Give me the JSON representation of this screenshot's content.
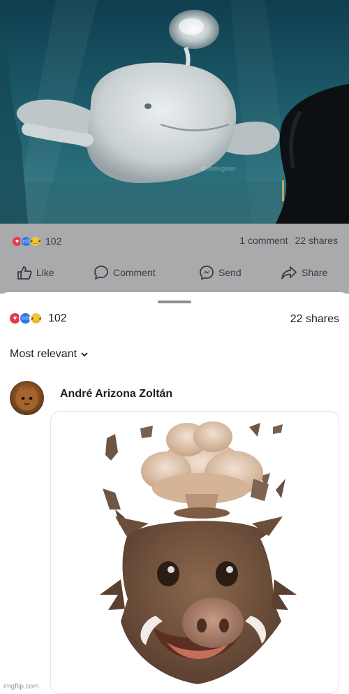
{
  "post": {
    "reaction_count": "102",
    "comments": "1 comment",
    "shares": "22 shares",
    "actions": {
      "like": "Like",
      "comment": "Comment",
      "send": "Send",
      "share": "Share"
    }
  },
  "sheet": {
    "reaction_count": "102",
    "shares": "22 shares",
    "sort_label": "Most relevant",
    "comment": {
      "author": "André Arizona Zoltán"
    }
  },
  "footer": {
    "watermark": "imgflip.com"
  },
  "icons": [
    "love-reaction-icon",
    "like-reaction-icon",
    "wow-reaction-icon",
    "like-icon",
    "comment-icon",
    "messenger-icon",
    "share-icon",
    "chevron-down-icon"
  ],
  "colors": {
    "love": "#e5394d",
    "like": "#2e78ee",
    "wow": "#f5c33b",
    "post_bar": "#a9aaac"
  }
}
